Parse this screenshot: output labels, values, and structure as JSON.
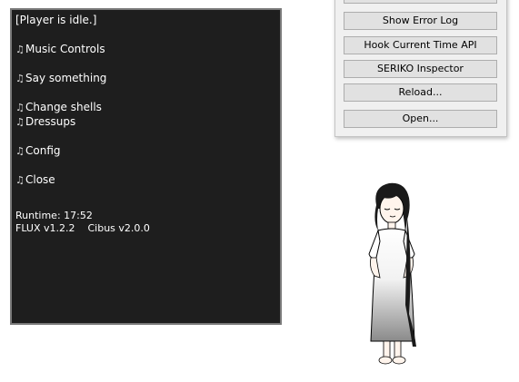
{
  "balloon": {
    "status": "[Player is idle.]",
    "items": [
      {
        "label": "Music Controls"
      },
      {
        "label": "Say something"
      },
      {
        "label": "Change shells"
      },
      {
        "label": "Dressups"
      },
      {
        "label": "Config"
      },
      {
        "label": "Close"
      }
    ],
    "runtime": "Runtime: 17:52",
    "version_line": "FLUX v1.2.2    Cibus v2.0.0",
    "note_icon": "music-note-icon"
  },
  "menu": {
    "buttons": [
      {
        "label": "Show Error Log"
      },
      {
        "label": "Hook Current Time API"
      },
      {
        "label": "SERIKO Inspector"
      },
      {
        "label": "Reload..."
      },
      {
        "label": "Open..."
      }
    ]
  },
  "colors": {
    "balloon_bg": "#1e1e1e",
    "balloon_border": "#7a7a7a",
    "button_bg": "#e1e1e1",
    "panel_bg": "#f0f0f0"
  }
}
